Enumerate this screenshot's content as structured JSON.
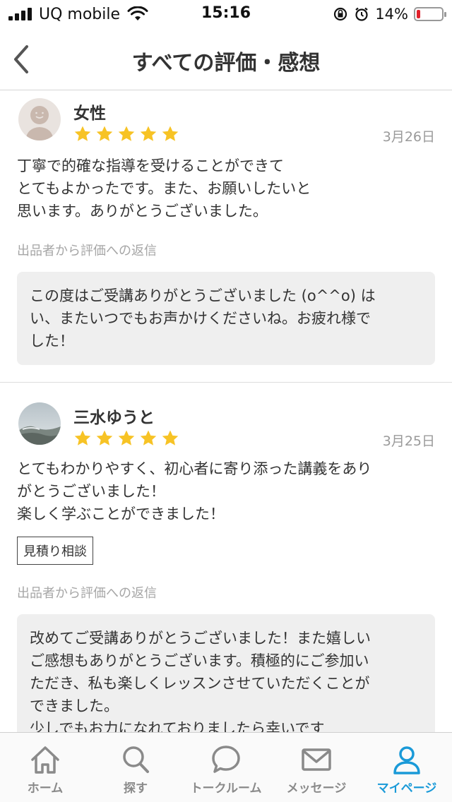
{
  "status_bar": {
    "carrier": "UQ mobile",
    "time": "15:16",
    "battery_percent_label": "14%",
    "battery_level": 0.14
  },
  "nav": {
    "title": "すべての評価・感想"
  },
  "reviews": [
    {
      "name": "女性",
      "stars": 5,
      "date": "3月26日",
      "body": "丁寧で的確な指導を受けることができて\nとてもよかったです。また、お願いしたいと\n思います。ありがとうございました。",
      "reply_label": "出品者から評価への返信",
      "reply": "この度はご受講ありがとうございました (o^^o) は\nい、またいつでもお声かけくださいね。お疲れ様で\nした！"
    },
    {
      "name": "三水ゆうと",
      "stars": 5,
      "date": "3月25日",
      "body": "とてもわかりやすく、初心者に寄り添った講義をあり\nがとうございました！\n楽しく学ぶことができました！",
      "tag": "見積り相談",
      "reply_label": "出品者から評価への返信",
      "reply": "改めてご受講ありがとうございました！また嬉しい\nご感想もありがとうございます。積極的にご参加い\nただき、私も楽しくレッスンさせていただくことが\nできました。\n少しでもお力になれておりましたら幸いです\n(o^^o)"
    }
  ],
  "tabs": [
    {
      "label": "ホーム",
      "icon": "home-icon"
    },
    {
      "label": "探す",
      "icon": "search-icon"
    },
    {
      "label": "トークルーム",
      "icon": "chat-bubble-icon"
    },
    {
      "label": "メッセージ",
      "icon": "mail-icon"
    },
    {
      "label": "マイページ",
      "icon": "person-icon",
      "active": true
    }
  ],
  "colors": {
    "star": "#f7c325",
    "accent": "#1a9ad8",
    "battery_low": "#e0202a"
  }
}
